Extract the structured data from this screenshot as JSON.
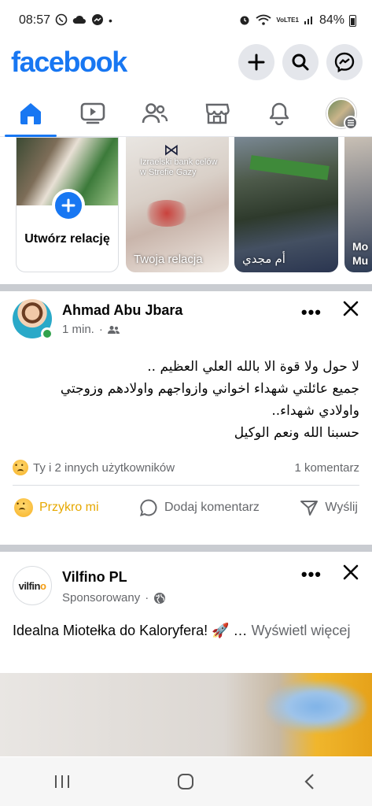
{
  "status": {
    "time": "08:57",
    "network": "VoLTE1",
    "battery": "84%"
  },
  "header": {
    "logo": "facebook",
    "brand_color": "#1877f2"
  },
  "nav": {
    "tabs": [
      "home-icon",
      "video-icon",
      "friends-icon",
      "marketplace-icon",
      "notifications-icon",
      "profile-menu"
    ],
    "active": "home-icon"
  },
  "stories": [
    {
      "label": "Utwórz relację",
      "type": "create"
    },
    {
      "label": "Twoja relacja",
      "overlay": "Izraelski bank celów w Strefie Gazy"
    },
    {
      "label": "أم مجدي"
    },
    {
      "label": "Mo Mu"
    }
  ],
  "post1": {
    "author": "Ahmad Abu Jbara",
    "time": "1 min.",
    "lines": [
      "لا حول ولا قوة الا بالله العلي العظيم ..",
      "جميع عائلتي شهداء اخواني وازواجهم واولادهم وزوجتي",
      "واولادي شهداء..",
      "حسبنا الله ونعم الوكيل"
    ],
    "reactions_text": "Ty i 2 innych użytkowników",
    "comments_count": "1 komentarz",
    "actions": {
      "react": "Przykro mi",
      "comment": "Dodaj komentarz",
      "share": "Wyślij"
    }
  },
  "post2": {
    "author": "Vilfino PL",
    "logo_text_main": "vilfin",
    "logo_text_accent": "o",
    "meta": "Sponsorowany",
    "text": "Idealna Miotełka do Kaloryfera! 🚀 …",
    "see_more": "Wyświetl więcej"
  }
}
